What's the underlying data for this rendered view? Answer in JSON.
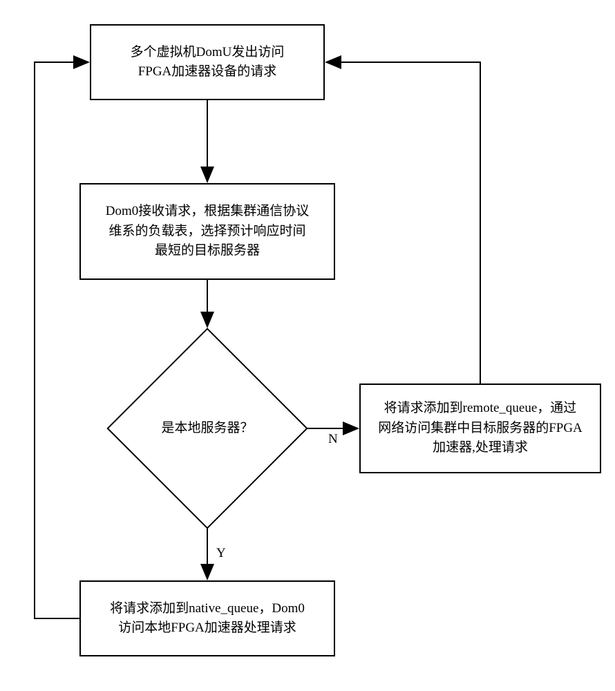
{
  "nodes": {
    "start": "多个虚拟机DomU发出访问\nFPGA加速器设备的请求",
    "select": "Dom0接收请求，根据集群通信协议\n维系的负载表，选择预计响应时间\n最短的目标服务器",
    "decision": "是本地服务器？",
    "remote": "将请求添加到remote_queue，通过\n网络访问集群中目标服务器的FPGA\n加速器,处理请求",
    "native": "将请求添加到native_queue，Dom0\n访问本地FPGA加速器处理请求"
  },
  "labels": {
    "no": "N",
    "yes": "Y"
  }
}
